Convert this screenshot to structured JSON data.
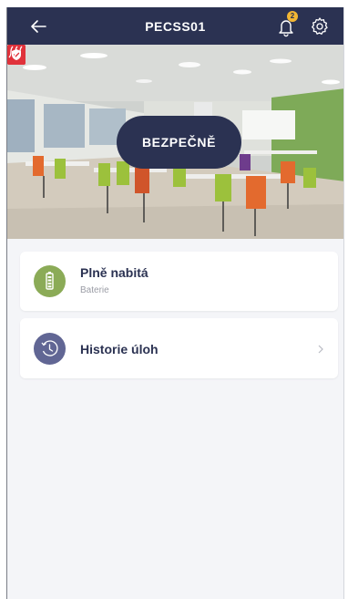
{
  "header": {
    "title": "PECSS01",
    "notification_count": "2"
  },
  "camera": {
    "status_label": "BEZPEČNĚ"
  },
  "battery": {
    "title": "Plně nabitá",
    "subtitle": "Baterie"
  },
  "history": {
    "title": "Historie úloh"
  },
  "colors": {
    "header_bg": "#2b3252",
    "battery_icon_bg": "#8bab57",
    "history_icon_bg": "#616694",
    "badge": "#f2b634",
    "alert_red": "#e0323b"
  },
  "icons": {
    "back": "arrow-left",
    "notifications": "bell",
    "settings": "gear",
    "protected": "shield",
    "signal": "signal-waves",
    "battery": "battery",
    "history": "clock-history",
    "open": "chevron-right"
  }
}
